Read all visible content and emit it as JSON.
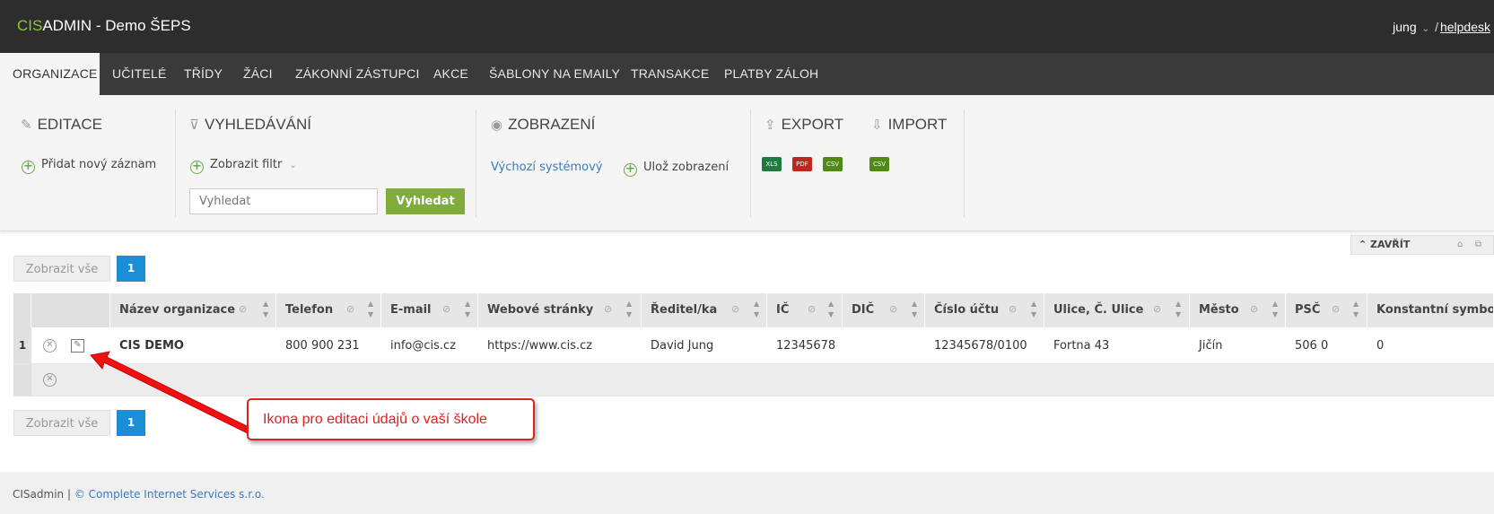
{
  "header": {
    "brand_prefix": "CIS",
    "brand_suffix": "ADMIN - Demo ŠEPS",
    "user": "jung",
    "separator": "/",
    "helpdesk": "helpdesk"
  },
  "nav": {
    "tabs": [
      {
        "label": "ORGANIZACE",
        "active": true
      },
      {
        "label": "UČITELÉ"
      },
      {
        "label": "TŘÍDY"
      },
      {
        "label": "ŽÁCI"
      },
      {
        "label": "ZÁKONNÍ ZÁSTUPCI"
      },
      {
        "label": "AKCE"
      },
      {
        "label": "ŠABLONY NA EMAILY"
      },
      {
        "label": "TRANSAKCE"
      },
      {
        "label": "PLATBY ZÁLOH"
      }
    ]
  },
  "toolbar": {
    "edit_title": "EDITACE",
    "add_record": "Přidat nový záznam",
    "search_title": "VYHLEDÁVÁNÍ",
    "show_filter": "Zobrazit filtr",
    "search_placeholder": "Vyhledat",
    "search_button": "Vyhledat",
    "view_title": "ZOBRAZENÍ",
    "default_view": "Výchozí systémový",
    "save_view": "Ulož zobrazení",
    "export_title": "EXPORT",
    "import_title": "IMPORT",
    "export_formats": [
      "XLS",
      "PDF",
      "CSV"
    ],
    "import_formats": [
      "CSV"
    ]
  },
  "close_panel": "ZAVŘÍT",
  "pager": {
    "show_all": "Zobrazit vše",
    "page": "1"
  },
  "table": {
    "columns": [
      "Název organizace",
      "Telefon",
      "E-mail",
      "Webové stránky",
      "Ředitel/ka",
      "IČ",
      "DIČ",
      "Číslo účtu",
      "Ulice, Č. Ulice",
      "Město",
      "PSČ",
      "Konstantní symbol"
    ],
    "rows": [
      {
        "num": "1",
        "cells": [
          "CIS DEMO",
          "800 900 231",
          "info@cis.cz",
          "https://www.cis.cz",
          "David Jung",
          "12345678",
          "",
          "12345678/0100",
          "Fortna 43",
          "Jičín",
          "506 0",
          "0"
        ]
      }
    ]
  },
  "annotation": "Ikona pro editaci údajů o vaší škole",
  "footer": {
    "app": "CISadmin",
    "sep": "|",
    "copyright": "© Complete Internet Services s.r.o."
  },
  "colors": {
    "accent_green": "#7fac3a",
    "brand_green": "#8dc63f",
    "link_blue": "#3a7bbf",
    "page_blue": "#1a8fd6",
    "annotation_red": "#dd2222"
  }
}
